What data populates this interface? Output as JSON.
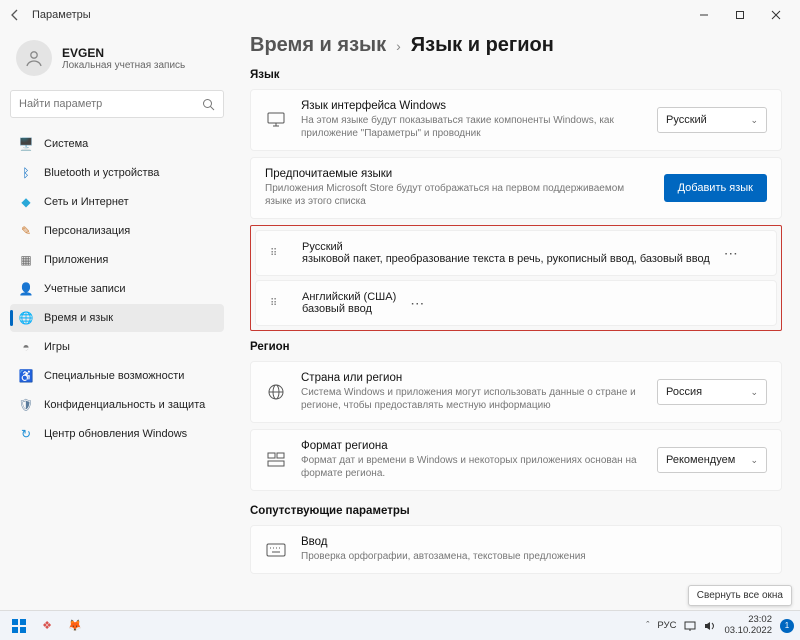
{
  "window": {
    "title": "Параметры"
  },
  "user": {
    "name": "EVGEN",
    "sub": "Локальная учетная запись"
  },
  "search": {
    "placeholder": "Найти параметр"
  },
  "nav": [
    {
      "label": "Система",
      "icon": "🖥️",
      "color": "#0067c0"
    },
    {
      "label": "Bluetooth и устройства",
      "icon": "ᛒ",
      "color": "#0067c0"
    },
    {
      "label": "Сеть и Интернет",
      "icon": "◆",
      "color": "#2aa8d8"
    },
    {
      "label": "Персонализация",
      "icon": "✎",
      "color": "#c9772b"
    },
    {
      "label": "Приложения",
      "icon": "▦",
      "color": "#6b6b6b"
    },
    {
      "label": "Учетные записи",
      "icon": "👤",
      "color": "#2e9e5b"
    },
    {
      "label": "Время и язык",
      "icon": "🌐",
      "color": "#3a7bbf"
    },
    {
      "label": "Игры",
      "icon": "◓",
      "color": "#777"
    },
    {
      "label": "Специальные возможности",
      "icon": "♿",
      "color": "#497ec5"
    },
    {
      "label": "Конфиденциальность и защита",
      "icon": "🛡",
      "color": "#5a7a9a"
    },
    {
      "label": "Центр обновления Windows",
      "icon": "↻",
      "color": "#1f8fd6"
    }
  ],
  "nav_active_index": 6,
  "breadcrumb": {
    "parent": "Время и язык",
    "current": "Язык и регион"
  },
  "sections": {
    "language_h": "Язык",
    "region_h": "Регион",
    "related_h": "Сопутствующие параметры"
  },
  "display_lang": {
    "title": "Язык интерфейса Windows",
    "desc": "На этом языке будут показываться такие компоненты Windows, как приложение \"Параметры\" и проводник",
    "value": "Русский"
  },
  "preferred": {
    "title": "Предпочитаемые языки",
    "desc": "Приложения Microsoft Store будут отображаться на первом поддерживаемом языке из этого списка",
    "button": "Добавить язык"
  },
  "languages": [
    {
      "name": "Русский",
      "desc": "языковой пакет, преобразование текста в речь, рукописный ввод, базовый ввод"
    },
    {
      "name": "Английский (США)",
      "desc": "базовый ввод"
    }
  ],
  "country": {
    "title": "Страна или регион",
    "desc": "Система Windows и приложения могут использовать данные о стране и регионе, чтобы предоставлять местную информацию",
    "value": "Россия"
  },
  "format": {
    "title": "Формат региона",
    "desc": "Формат дат и времени в Windows и некоторых приложениях основан на формате региона.",
    "value": "Рекомендуем"
  },
  "input": {
    "title": "Ввод",
    "desc": "Проверка орфографии, автозамена, текстовые предложения"
  },
  "tooltip": "Свернуть все окна",
  "tray": {
    "lang": "РУС",
    "time": "23:02",
    "date": "03.10.2022"
  }
}
